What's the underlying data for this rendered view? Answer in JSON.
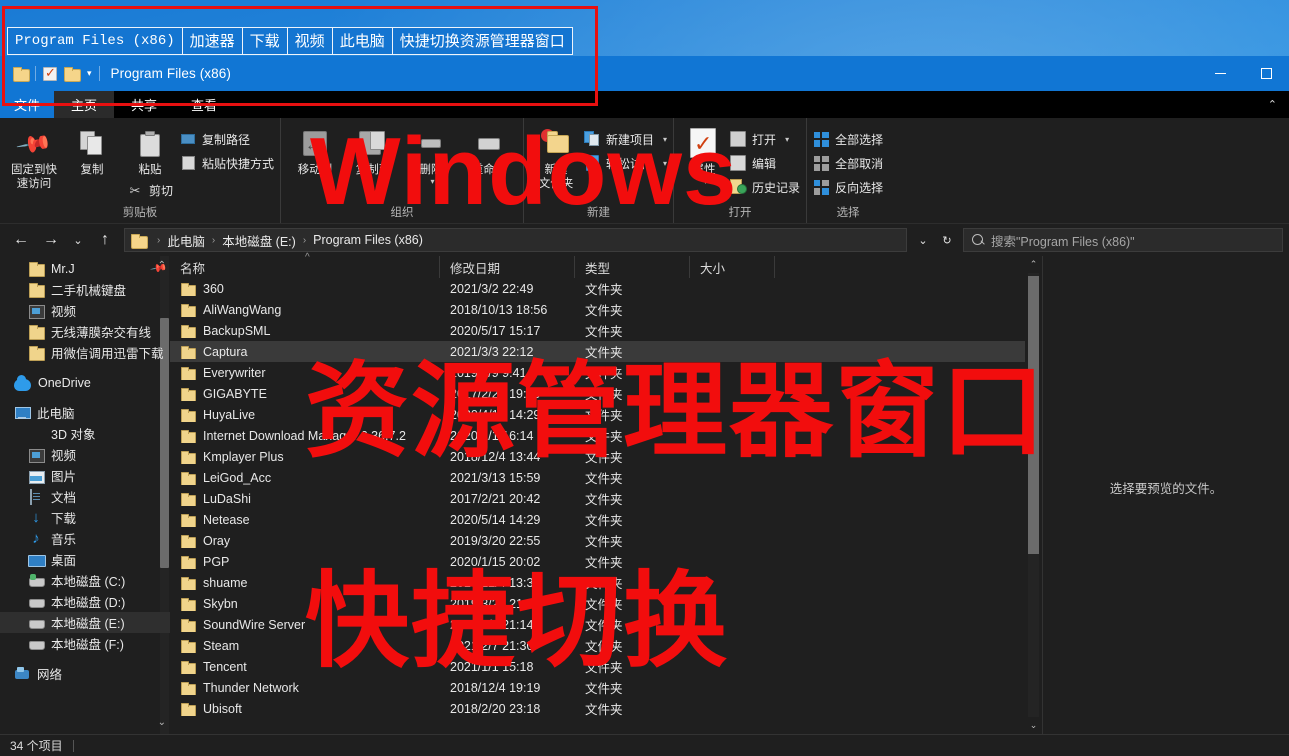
{
  "tabstrip": {
    "tabs": [
      {
        "label": "Program Files (x86)",
        "mono": true
      },
      {
        "label": "加速器",
        "mono": false
      },
      {
        "label": "下载",
        "mono": false
      },
      {
        "label": "视频",
        "mono": false
      },
      {
        "label": "此电脑",
        "mono": false
      },
      {
        "label": "快捷切换资源管理器窗口",
        "mono": false
      }
    ]
  },
  "titlebar": {
    "title": "Program Files (x86)",
    "qat": [
      "folder-icon",
      "properties-icon",
      "new-folder-icon"
    ],
    "dropdown": "▾",
    "minimize": "minimize-icon",
    "maximize": "maximize-icon"
  },
  "ribbon_tabs": [
    {
      "label": "文件",
      "state": "file"
    },
    {
      "label": "主页",
      "state": "active"
    },
    {
      "label": "共享",
      "state": "normal"
    },
    {
      "label": "查看",
      "state": "normal"
    }
  ],
  "ribbon_collapse": "⌃",
  "ribbon": {
    "groups": [
      {
        "title": "剪贴板",
        "big": [
          {
            "label": "固定到快\n速访问",
            "icon": "pin-icon"
          },
          {
            "label": "复制",
            "icon": "copy-icon"
          },
          {
            "label": "粘贴",
            "icon": "paste-icon"
          }
        ],
        "small_under_paste": [
          {
            "label": "剪切",
            "icon": "scissors-icon"
          }
        ],
        "small": [
          {
            "label": "复制路径",
            "icon": "copy-path-icon"
          },
          {
            "label": "粘贴快捷方式",
            "icon": "paste-shortcut-icon"
          }
        ]
      },
      {
        "title": "组织",
        "big": [
          {
            "label": "移动到",
            "icon": "move-to-icon"
          },
          {
            "label": "复制到",
            "icon": "copy-to-icon"
          },
          {
            "label": "删除",
            "icon": "delete-icon",
            "caret": "▾"
          },
          {
            "label": "重命名",
            "icon": "rename-icon"
          }
        ]
      },
      {
        "title": "新建",
        "big": [
          {
            "label": "新建\n文件夹",
            "icon": "new-folder-icon"
          }
        ],
        "small": [
          {
            "label": "新建项目",
            "icon": "new-item-icon",
            "caret": "▾"
          },
          {
            "label": "轻松访问",
            "icon": "easy-access-icon",
            "caret": "▾"
          }
        ]
      },
      {
        "title": "打开",
        "big": [
          {
            "label": "属性",
            "icon": "properties-icon",
            "caret": "▾"
          }
        ],
        "small": [
          {
            "label": "打开",
            "icon": "open-icon",
            "caret": "▾"
          },
          {
            "label": "编辑",
            "icon": "edit-icon"
          },
          {
            "label": "历史记录",
            "icon": "history-icon"
          }
        ]
      },
      {
        "title": "选择",
        "small": [
          {
            "label": "全部选择",
            "icon": "select-all-icon"
          },
          {
            "label": "全部取消",
            "icon": "select-none-icon"
          },
          {
            "label": "反向选择",
            "icon": "invert-selection-icon"
          }
        ]
      }
    ]
  },
  "address": {
    "back": "←",
    "forward": "→",
    "recent": "⌄",
    "up": "↑",
    "crumbs": [
      "此电脑",
      "本地磁盘 (E:)",
      "Program Files (x86)"
    ],
    "crumb_sep": "›",
    "history_caret": "⌄",
    "refresh": "↻",
    "search_placeholder": "搜索\"Program Files (x86)\""
  },
  "navpane": {
    "items": [
      {
        "label": "Mr.J",
        "icon": "folder-icon",
        "indent": 1,
        "pinned": true
      },
      {
        "label": "二手机械键盘",
        "icon": "folder-icon",
        "indent": 1
      },
      {
        "label": "视频",
        "icon": "video-icon",
        "indent": 1
      },
      {
        "label": "无线薄膜杂交有线",
        "icon": "folder-icon",
        "indent": 1
      },
      {
        "label": "用微信调用迅雷下载",
        "icon": "folder-icon",
        "indent": 1
      },
      {
        "gap": true
      },
      {
        "label": "OneDrive",
        "icon": "cloud-icon",
        "indent": 0
      },
      {
        "gap": true
      },
      {
        "label": "此电脑",
        "icon": "pc-icon",
        "indent": 0
      },
      {
        "label": "3D 对象",
        "icon": "cube-icon",
        "indent": 1
      },
      {
        "label": "视频",
        "icon": "video-icon",
        "indent": 1
      },
      {
        "label": "图片",
        "icon": "pictures-icon",
        "indent": 1
      },
      {
        "label": "文档",
        "icon": "documents-icon",
        "indent": 1
      },
      {
        "label": "下载",
        "icon": "downloads-icon",
        "indent": 1
      },
      {
        "label": "音乐",
        "icon": "music-icon",
        "indent": 1
      },
      {
        "label": "桌面",
        "icon": "desktop-icon",
        "indent": 1
      },
      {
        "label": "本地磁盘 (C:)",
        "icon": "system-drive-icon",
        "indent": 1
      },
      {
        "label": "本地磁盘 (D:)",
        "icon": "drive-icon",
        "indent": 1
      },
      {
        "label": "本地磁盘 (E:)",
        "icon": "drive-icon",
        "indent": 1,
        "selected": true
      },
      {
        "label": "本地磁盘 (F:)",
        "icon": "drive-icon",
        "indent": 1
      },
      {
        "gap": true
      },
      {
        "label": "网络",
        "icon": "network-icon",
        "indent": 0
      }
    ],
    "collapse_up": "⌃",
    "collapse_down": "⌄"
  },
  "filelist": {
    "columns": [
      "名称",
      "修改日期",
      "类型",
      "大小"
    ],
    "sort_indicator": "^",
    "rows": [
      {
        "name": "360",
        "date": "2021/3/2 22:49",
        "type": "文件夹",
        "size": ""
      },
      {
        "name": "AliWangWang",
        "date": "2018/10/13 18:56",
        "type": "文件夹",
        "size": ""
      },
      {
        "name": "BackupSML",
        "date": "2020/5/17 15:17",
        "type": "文件夹",
        "size": ""
      },
      {
        "name": "Captura",
        "date": "2021/3/3 22:12",
        "type": "文件夹",
        "size": "",
        "selected": true
      },
      {
        "name": "Everywriter",
        "date": "2019/4/9 9:41",
        "type": "文件夹",
        "size": ""
      },
      {
        "name": "GIGABYTE",
        "date": "2017/2/21 19:50",
        "type": "文件夹",
        "size": ""
      },
      {
        "name": "HuyaLive",
        "date": "2020/4/14 14:29",
        "type": "文件夹",
        "size": ""
      },
      {
        "name": "Internet Download Manager 6.36.7.2",
        "date": "2020/1/1 16:14",
        "type": "文件夹",
        "size": ""
      },
      {
        "name": "Kmplayer Plus",
        "date": "2018/12/4 13:44",
        "type": "文件夹",
        "size": ""
      },
      {
        "name": "LeiGod_Acc",
        "date": "2021/3/13 15:59",
        "type": "文件夹",
        "size": ""
      },
      {
        "name": "LuDaShi",
        "date": "2017/2/21 20:42",
        "type": "文件夹",
        "size": ""
      },
      {
        "name": "Netease",
        "date": "2020/5/14 14:29",
        "type": "文件夹",
        "size": ""
      },
      {
        "name": "Oray",
        "date": "2019/3/20 22:55",
        "type": "文件夹",
        "size": ""
      },
      {
        "name": "PGP",
        "date": "2020/1/15 20:02",
        "type": "文件夹",
        "size": ""
      },
      {
        "name": "shuame",
        "date": "2018/12/4 13:33",
        "type": "文件夹",
        "size": ""
      },
      {
        "name": "Skybn",
        "date": "2019/3/29 21:07",
        "type": "文件夹",
        "size": ""
      },
      {
        "name": "SoundWire Server",
        "date": "2020/1/3 21:14",
        "type": "文件夹",
        "size": ""
      },
      {
        "name": "Steam",
        "date": "2021/2/7 21:30",
        "type": "文件夹",
        "size": ""
      },
      {
        "name": "Tencent",
        "date": "2021/1/1 15:18",
        "type": "文件夹",
        "size": ""
      },
      {
        "name": "Thunder Network",
        "date": "2018/12/4 19:19",
        "type": "文件夹",
        "size": ""
      },
      {
        "name": "Ubisoft",
        "date": "2018/2/20 23:18",
        "type": "文件夹",
        "size": ""
      }
    ]
  },
  "preview": {
    "message": "选择要预览的文件。"
  },
  "statusbar": {
    "count": "34 个项目"
  },
  "watermarks": [
    {
      "text": "Windows"
    },
    {
      "text": "资源管理器窗口"
    },
    {
      "text": "快捷切换"
    }
  ],
  "colors": {
    "accent_blue": "#1176d4",
    "watermark_red": "#f20d0d",
    "window_bg": "#1f1f1f",
    "folder_yellow": "#f0d48b"
  }
}
